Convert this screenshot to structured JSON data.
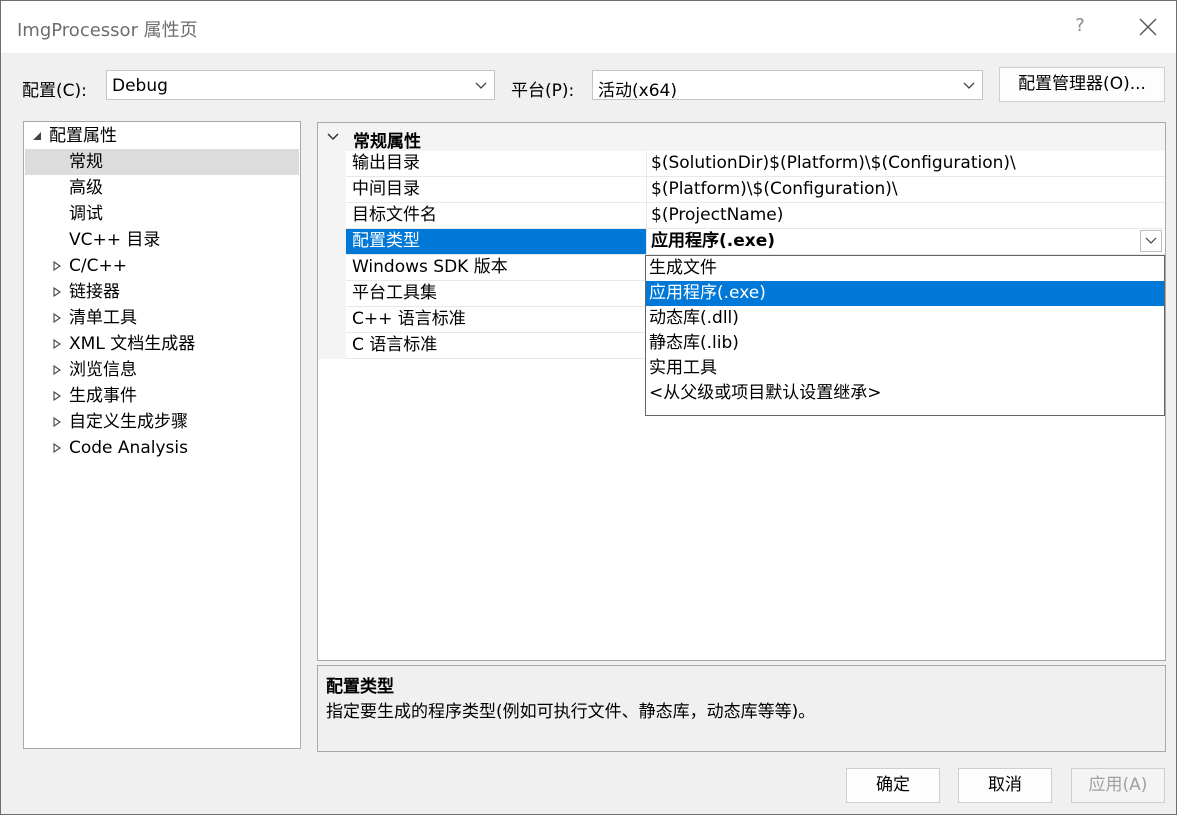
{
  "window": {
    "title": "ImgProcessor 属性页",
    "help_label": "?"
  },
  "config_bar": {
    "configuration_label": "配置(C):",
    "configuration_value": "Debug",
    "platform_label": "平台(P):",
    "platform_value": "活动(x64)",
    "config_manager_label": "配置管理器(O)..."
  },
  "tree": {
    "root": {
      "label": "配置属性",
      "expanded": true
    },
    "items": [
      {
        "label": "常规",
        "selected": true,
        "expandable": false
      },
      {
        "label": "高级",
        "selected": false,
        "expandable": false
      },
      {
        "label": "调试",
        "selected": false,
        "expandable": false
      },
      {
        "label": "VC++ 目录",
        "selected": false,
        "expandable": false
      },
      {
        "label": "C/C++",
        "selected": false,
        "expandable": true
      },
      {
        "label": "链接器",
        "selected": false,
        "expandable": true
      },
      {
        "label": "清单工具",
        "selected": false,
        "expandable": true
      },
      {
        "label": "XML 文档生成器",
        "selected": false,
        "expandable": true
      },
      {
        "label": "浏览信息",
        "selected": false,
        "expandable": true
      },
      {
        "label": "生成事件",
        "selected": false,
        "expandable": true
      },
      {
        "label": "自定义生成步骤",
        "selected": false,
        "expandable": true
      },
      {
        "label": "Code Analysis",
        "selected": false,
        "expandable": true
      }
    ]
  },
  "grid": {
    "category": "常规属性",
    "rows": [
      {
        "name": "输出目录",
        "value": "$(SolutionDir)$(Platform)\\$(Configuration)\\"
      },
      {
        "name": "中间目录",
        "value": "$(Platform)\\$(Configuration)\\"
      },
      {
        "name": "目标文件名",
        "value": "$(ProjectName)"
      },
      {
        "name": "配置类型",
        "value": "应用程序(.exe)"
      },
      {
        "name": "Windows SDK 版本",
        "value": ""
      },
      {
        "name": "平台工具集",
        "value": ""
      },
      {
        "name": "C++ 语言标准",
        "value": ""
      },
      {
        "name": "C 语言标准",
        "value": ""
      }
    ],
    "selected_row": 3
  },
  "dropdown": {
    "options": [
      {
        "label": "生成文件",
        "selected": false
      },
      {
        "label": "应用程序(.exe)",
        "selected": true
      },
      {
        "label": "动态库(.dll)",
        "selected": false
      },
      {
        "label": "静态库(.lib)",
        "selected": false
      },
      {
        "label": "实用工具",
        "selected": false
      },
      {
        "label": "<从父级或项目默认设置继承>",
        "selected": false
      }
    ]
  },
  "description": {
    "title": "配置类型",
    "text": "指定要生成的程序类型(例如可执行文件、静态库，动态库等等)。"
  },
  "footer": {
    "ok_label": "确定",
    "cancel_label": "取消",
    "apply_label": "应用(A)",
    "apply_enabled": false
  },
  "colors": {
    "selection_blue": "#0078d7",
    "tree_selection_gray": "#dcdcdc",
    "dialog_background": "#f0f0f0"
  }
}
